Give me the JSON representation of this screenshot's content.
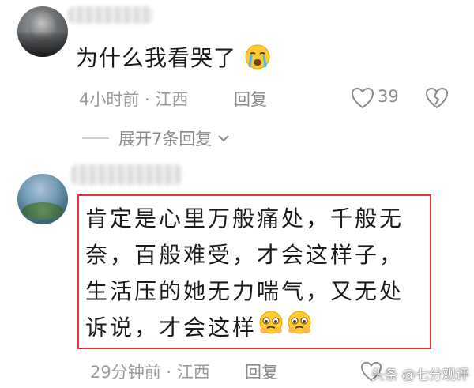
{
  "comments": [
    {
      "text": "为什么我看哭了",
      "emoji": "loudly-crying-face",
      "time": "4小时前 · 江西",
      "reply_label": "回复",
      "likes": "39",
      "expand_label": "展开7条回复"
    },
    {
      "text": "肯定是心里万般痛处，千般无奈，百般难受，才会这样子，生活压的她无力喘气，又无处诉说，才会这样",
      "emoji": "crying-face",
      "time": "29分钟前 · 江西",
      "reply_label": "回复"
    }
  ],
  "watermark": "头条 @七分观评",
  "colors": {
    "highlight_border": "#e33333",
    "meta_text": "#9a9a9a"
  }
}
